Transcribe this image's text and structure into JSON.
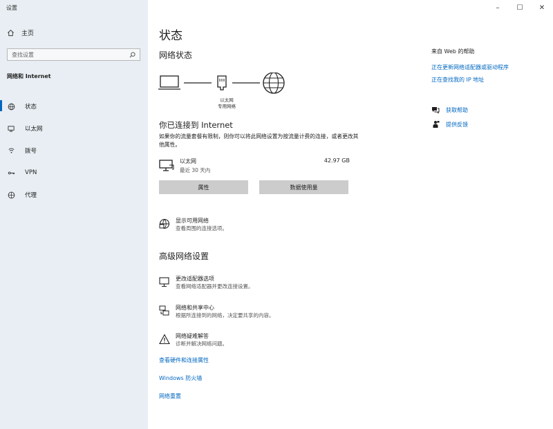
{
  "window": {
    "title": "设置",
    "controls": [
      "–",
      "☐",
      "✕"
    ]
  },
  "sidebar": {
    "home_label": "主页",
    "search_placeholder": "查找设置",
    "section_title": "网络和 Internet",
    "items": [
      {
        "label": "状态",
        "icon": "globe-status-icon",
        "active": true
      },
      {
        "label": "以太网",
        "icon": "ethernet-icon",
        "active": false
      },
      {
        "label": "拨号",
        "icon": "dialup-icon",
        "active": false
      },
      {
        "label": "VPN",
        "icon": "vpn-icon",
        "active": false
      },
      {
        "label": "代理",
        "icon": "globe-icon",
        "active": false
      }
    ]
  },
  "main": {
    "title": "状态",
    "network_status_title": "网络状态",
    "diagram": {
      "ethernet_label": "以太网",
      "network_label": "专用网络"
    },
    "connected_title": "你已连接到 Internet",
    "connected_desc": "如果你的流量套餐有限制，则你可以将此网络设置为按流量计费的连接，或者更改其他属性。",
    "adapter": {
      "name": "以太网",
      "period": "最近 30 天内",
      "usage": "42.97 GB"
    },
    "buttons": {
      "properties": "属性",
      "data_usage": "数据使用量"
    },
    "show_networks": {
      "title": "显示可用网络",
      "desc": "查看周围的连接选项。"
    },
    "advanced_title": "高级网络设置",
    "advanced_items": [
      {
        "title": "更改适配器选项",
        "desc": "查看网络适配器并更改连接设置。",
        "icon": "adapter-icon"
      },
      {
        "title": "网络和共享中心",
        "desc": "根据所连接到的网络，决定要共享的内容。",
        "icon": "sharing-center-icon"
      },
      {
        "title": "网络疑难解答",
        "desc": "诊断并解决网络问题。",
        "icon": "warning-icon"
      }
    ],
    "links": {
      "hardware": "查看硬件和连接属性",
      "firewall": "Windows 防火墙",
      "reset": "网络重置"
    }
  },
  "help": {
    "title": "来自 Web 的帮助",
    "links": [
      "正在更新网络适配器或驱动程序",
      "正在查找我的 IP 地址"
    ],
    "get_help": "获取帮助",
    "feedback": "提供反馈"
  },
  "colors": {
    "accent": "#0067c0",
    "sidebar_bg": "#e8eef3",
    "button_bg": "#cccccc"
  }
}
